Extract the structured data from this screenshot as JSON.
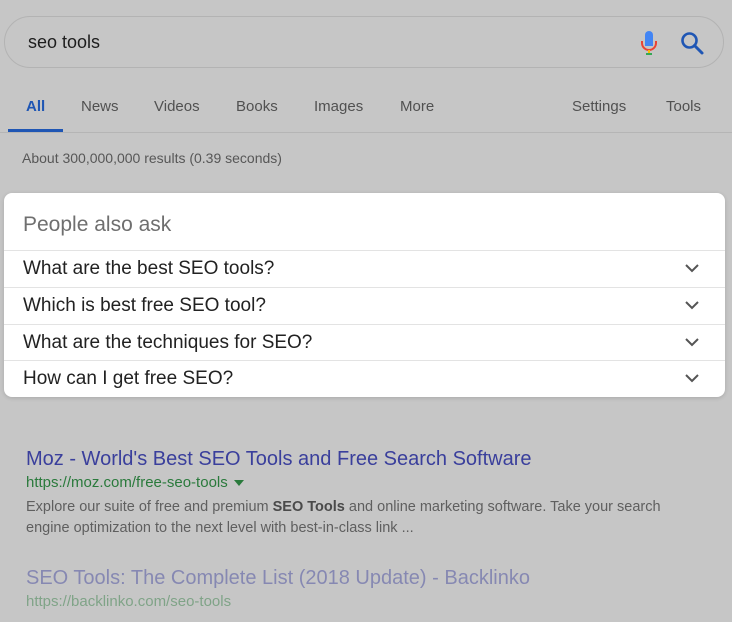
{
  "search": {
    "query": "seo tools"
  },
  "tabs": [
    {
      "label": "All",
      "active": true
    },
    {
      "label": "News"
    },
    {
      "label": "Videos"
    },
    {
      "label": "Books"
    },
    {
      "label": "Images"
    },
    {
      "label": "More"
    },
    {
      "label": "Settings"
    },
    {
      "label": "Tools"
    }
  ],
  "results_stats": "About 300,000,000 results (0.39 seconds)",
  "people_also_ask": {
    "title": "People also ask",
    "questions": [
      "What are the best SEO tools?",
      "Which is best free SEO tool?",
      "What are the techniques for SEO?",
      "How can I get free SEO?"
    ]
  },
  "results": [
    {
      "title": "Moz - World's Best SEO Tools and Free Search Software",
      "url": "https://moz.com/free-seo-tools",
      "snippet_before": "Explore our suite of free and premium ",
      "snippet_bold": "SEO Tools",
      "snippet_after": " and online marketing software. Take your search engine optimization to the next level with best-in-class link ..."
    },
    {
      "title": "SEO Tools: The Complete List (2018 Update) - Backlinko",
      "url": "https://backlinko.com/seo-tools"
    }
  ],
  "colors": {
    "link_title": "#3a3f9c",
    "link_url": "#2a7a3c",
    "accent_blue": "#1f56b4",
    "overlay_gray": "#c6c6c6"
  }
}
